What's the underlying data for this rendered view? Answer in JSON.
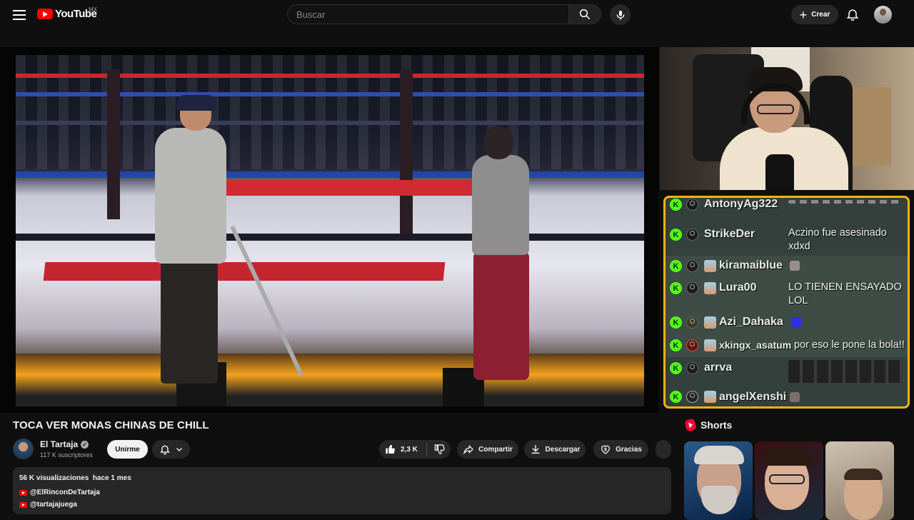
{
  "header": {
    "logo_text": "YouTube",
    "region": "MX",
    "search_placeholder": "Buscar",
    "create_label": "Crear"
  },
  "chat": {
    "messages": [
      {
        "user": "AntonyAg322",
        "text": "",
        "badges": [
          "kick",
          "user"
        ]
      },
      {
        "user": "StrikeDer",
        "text": "Aczino fue asesinado xdxd",
        "badges": [
          "kick",
          "user"
        ]
      },
      {
        "user": "kiramaiblue",
        "text": "",
        "badges": [
          "kick",
          "user",
          "subscriber"
        ]
      },
      {
        "user": "Lura00",
        "text": "LO TIENEN ENSAYADO LOL",
        "badges": [
          "kick",
          "user",
          "subscriber"
        ]
      },
      {
        "user": "Azi_Dahaka",
        "text": "",
        "badges": [
          "kick",
          "user",
          "subscriber"
        ]
      },
      {
        "user": "xkingx_asatum",
        "text": "por eso le pone la bola!!",
        "badges": [
          "kick",
          "user",
          "subscriber"
        ]
      },
      {
        "user": "arrva",
        "text": "",
        "badges": [
          "kick",
          "user"
        ]
      },
      {
        "user": "angelXenshi",
        "text": "",
        "badges": [
          "kick",
          "user",
          "subscriber"
        ]
      }
    ],
    "border_color": "#f6b313"
  },
  "video": {
    "title": "TOCA VER MONAS CHINAS DE CHILL",
    "channel_name": "El Tartaja",
    "subscribers": "117 K suscriptores",
    "join_label": "Unirme",
    "likes": "2,3 K",
    "share_label": "Compartir",
    "download_label": "Descargar",
    "thanks_label": "Gracias"
  },
  "description": {
    "views": "56 K visualizaciones",
    "date": "hace 1 mes",
    "links": [
      "@ElRinconDeTartaja",
      "@tartajajuega"
    ]
  },
  "shorts": {
    "title": "Shorts"
  },
  "colors": {
    "background": "#0f0f0f",
    "brand_red": "#ff0000",
    "kick_green": "#53fc18"
  }
}
